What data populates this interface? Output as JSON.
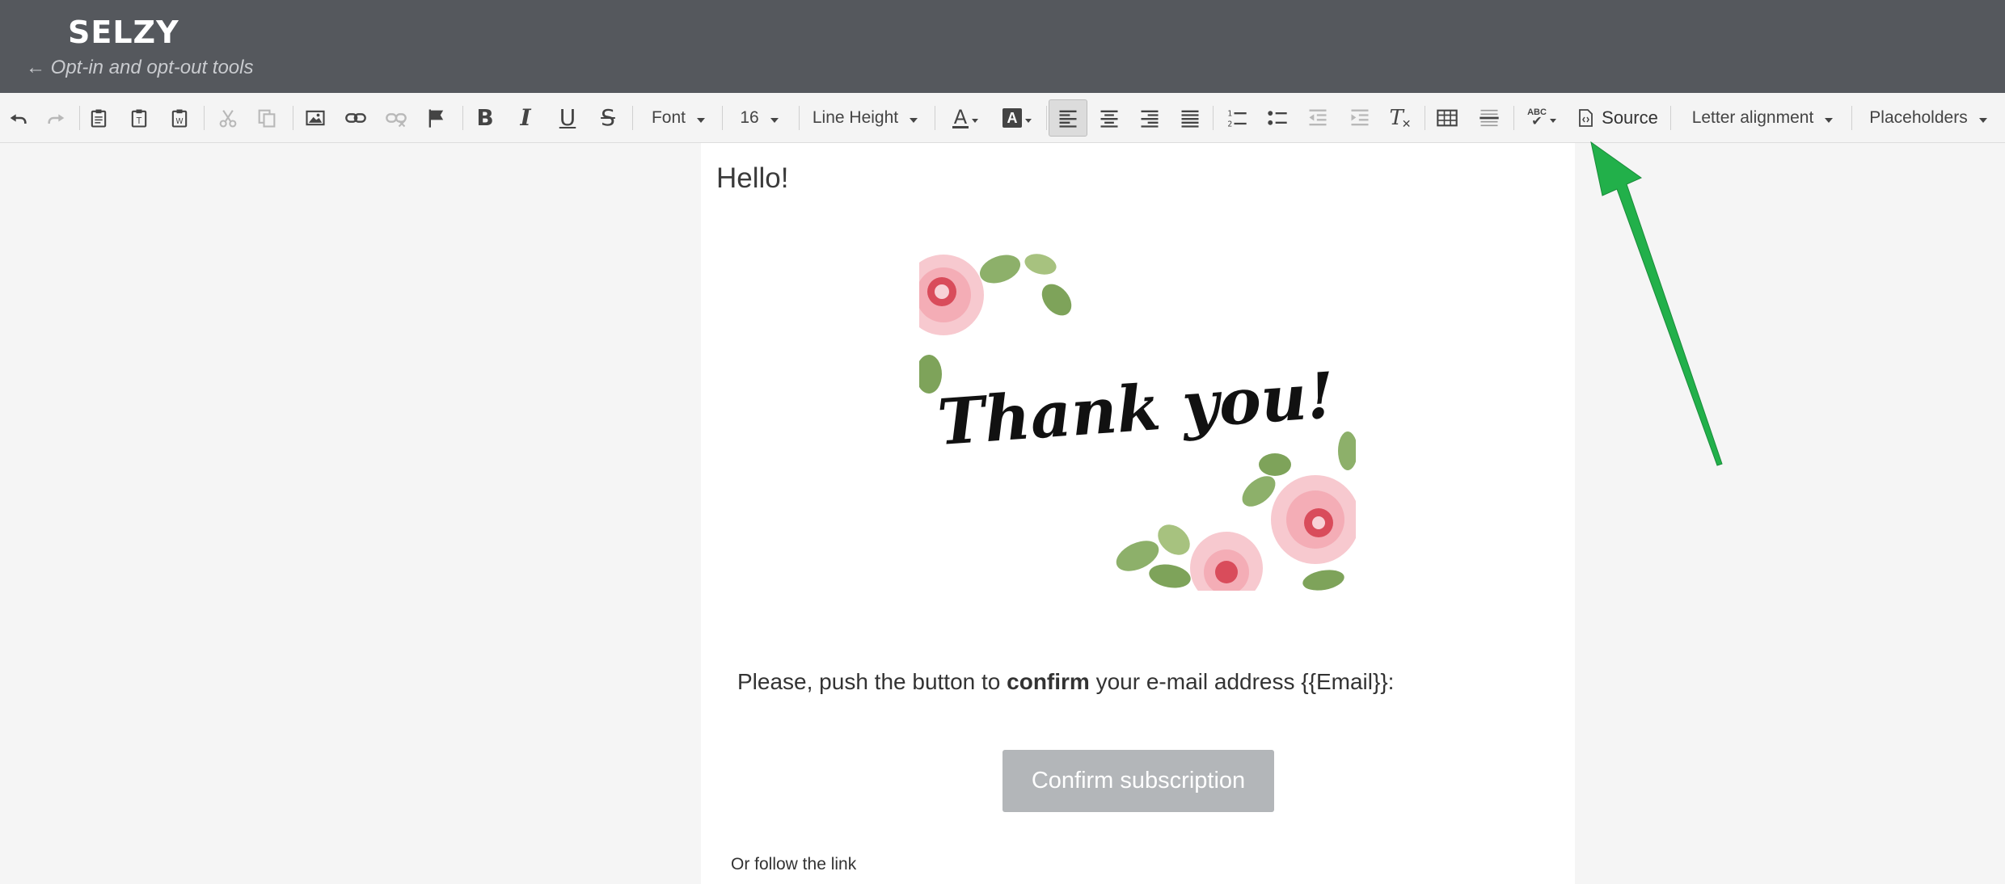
{
  "header": {
    "logo": "SELZY",
    "back_link": "← Opt-in and opt-out tools"
  },
  "toolbar": {
    "icons": [
      "undo-icon",
      "redo-icon",
      "paste-icon",
      "paste-text-icon",
      "paste-word-icon",
      "cut-icon",
      "copy-icon",
      "image-icon",
      "link-icon",
      "unlink-icon",
      "anchor-flag-icon",
      "bold-icon",
      "italic-icon",
      "underline-icon",
      "strikethrough-icon",
      "text-color-icon",
      "background-color-icon",
      "align-left-icon",
      "align-center-icon",
      "align-right-icon",
      "align-justify-icon",
      "numbered-list-icon",
      "bulleted-list-icon",
      "decrease-indent-icon",
      "increase-indent-icon",
      "remove-format-icon",
      "table-icon",
      "horizontal-rule-icon",
      "spellcheck-icon",
      "source-icon"
    ],
    "font_label": "Font",
    "size_label": "16",
    "line_height_label": "Line Height",
    "source_label": "Source",
    "letter_alignment_label": "Letter alignment",
    "placeholders_label": "Placeholders",
    "spellcheck_text": "ABC",
    "active_tool": "align-left"
  },
  "letter": {
    "greeting": "Hello!",
    "card_text": "Thank you!",
    "instruction_before": "Please, push the button to ",
    "instruction_bold": "confirm",
    "instruction_after": " your e-mail address {{Email}}:",
    "button_label": "Confirm subscription",
    "follow_link": "Or follow the link"
  },
  "colors": {
    "header_bg": "#55585d",
    "button_bg": "#b3b6b9",
    "annotation_arrow": "#22b04a"
  }
}
